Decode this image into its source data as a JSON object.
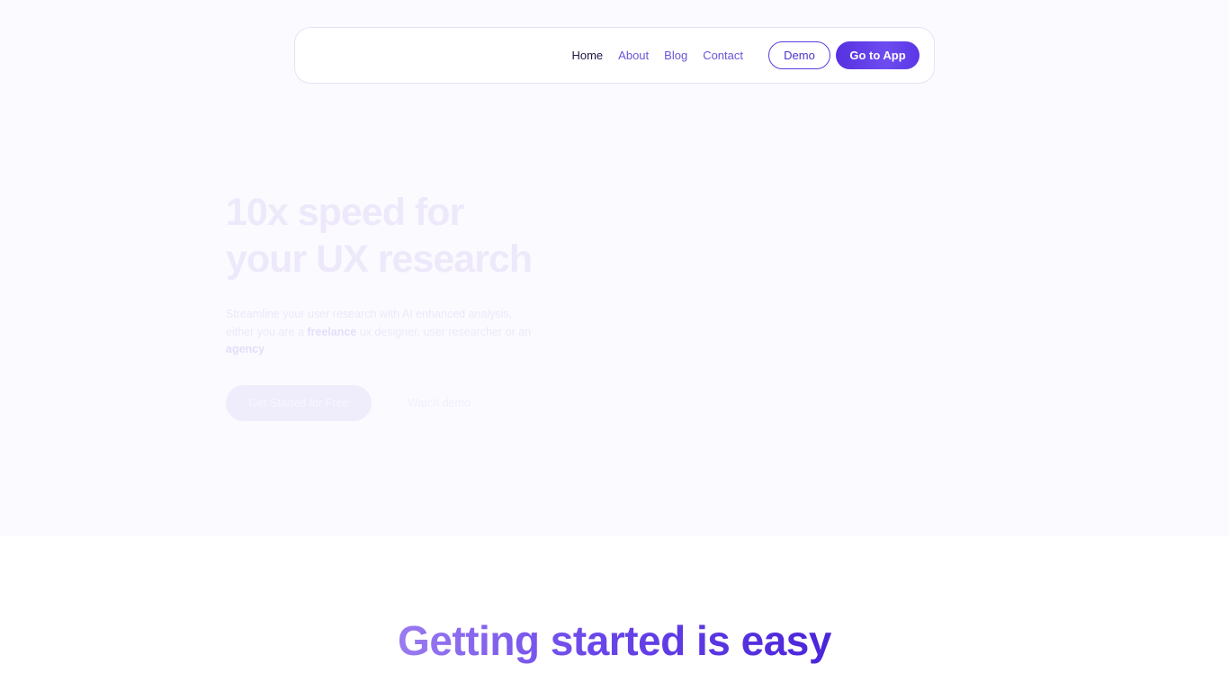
{
  "nav": {
    "links": [
      "Home",
      "About",
      "Blog",
      "Contact"
    ],
    "active": "Home",
    "demo_label": "Demo",
    "app_label": "Go to App"
  },
  "hero": {
    "title_line1": "10x speed for",
    "title_line2": "your UX research",
    "description_parts": {
      "p1": "Streamline your user research with AI enhanced analysis, either you are a ",
      "freelance": "freelance",
      "p2": " ux designer, user researcher or an ",
      "agency": "agency"
    },
    "cta_primary": "Get Started for Free",
    "cta_secondary": "Watch demo"
  },
  "section": {
    "title": "Getting started is easy"
  },
  "colors": {
    "accent": "#5631e0",
    "hero_bg": "#fbfaff",
    "nav_text": "#6a55d8"
  }
}
